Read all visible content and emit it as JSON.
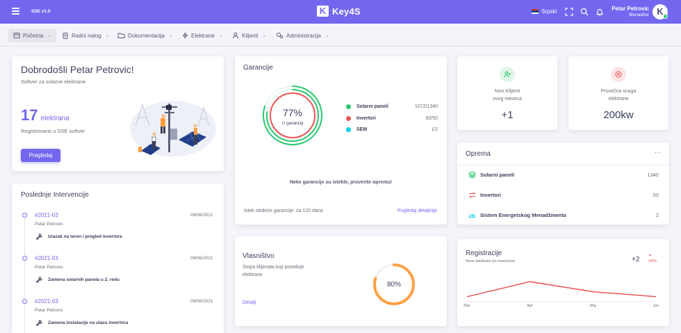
{
  "app": {
    "version": "SSE v1.0",
    "brand_letter": "K",
    "brand_name": "Key4S",
    "language": "Srpski"
  },
  "user": {
    "name": "Petar Petrovic",
    "role": "Menadžer",
    "avatar_letter": "K"
  },
  "nav": [
    {
      "label": "Početna",
      "icon": "home-icon"
    },
    {
      "label": "Radni nalog",
      "icon": "clipboard-icon"
    },
    {
      "label": "Dokumentacija",
      "icon": "folder-icon"
    },
    {
      "label": "Elektrane",
      "icon": "lightning-icon"
    },
    {
      "label": "Klijenti",
      "icon": "user-icon"
    },
    {
      "label": "Administracija",
      "icon": "settings-icon"
    }
  ],
  "welcome": {
    "title": "Dobrodošli Petar Petrovic!",
    "subtitle": "Softver za solarne elektrane",
    "count": "17",
    "count_unit": "elektrana",
    "registered": "Registrovano u SSE softver",
    "button": "Pregledaj"
  },
  "guarantees": {
    "title": "Garancije",
    "percent": "77%",
    "center_label": "U garanciji",
    "percent_value": 77,
    "items": [
      {
        "label": "Solarni paneli",
        "value": "1072/1340",
        "color": "#28c76f"
      },
      {
        "label": "Invertori",
        "value": "50/50",
        "color": "#ea5455"
      },
      {
        "label": "SEM",
        "value": "1/2",
        "color": "#00cfe8"
      }
    ],
    "warning": "Neke garancije su istekle, proverite opremu!",
    "expiry": "Istek sledeće garancije: za 120 dana",
    "details_link": "Pogledaj detaljnije"
  },
  "stat_new_clients": {
    "label_line1": "Novi Klijenti",
    "label_line2": "ovog meseca",
    "value": "+1",
    "color": "#28c76f"
  },
  "stat_avg_power": {
    "label_line1": "Prosečna snaga",
    "label_line2": "elektrane",
    "value": "200kw",
    "color": "#ea5455"
  },
  "equipment": {
    "title": "Oprema",
    "menu": "···",
    "items": [
      {
        "label": "Solarni paneli",
        "value": "1340",
        "color": "#28c76f",
        "icon": "layers-icon"
      },
      {
        "label": "Invertori",
        "value": "50",
        "color": "#ea5455",
        "icon": "swap-arrows-icon"
      },
      {
        "label": "Sistem Energetskog Menadžmenta",
        "value": "2",
        "color": "#00cfe8",
        "icon": "gauge-icon"
      }
    ]
  },
  "interventions": {
    "title": "Poslednje Intervencije",
    "items": [
      {
        "id": "#2021-03",
        "date": "08/06/2021",
        "person": "Petar Petrovic",
        "task": "Izlazak na teren i pregled invertora"
      },
      {
        "id": "#2021-03",
        "date": "08/06/2021",
        "person": "Petar Petrovic",
        "task": "Zamena solarnih panela u 2. redu"
      },
      {
        "id": "#2021-03",
        "date": "08/06/2021",
        "person": "Petar Petrovic",
        "task": "Zamena instalacije na ulazu invertora"
      }
    ]
  },
  "ownership": {
    "title": "Vlasništvo",
    "text_line1": "Stopa klijenata koji poseduje",
    "text_line2": "elektrane",
    "link": "Detalji",
    "percent": "80%",
    "percent_value": 80,
    "color": "#ff9f43"
  },
  "registrations": {
    "title": "Registracije",
    "subtitle": "Nove elektrane po mesecima",
    "value": "+2",
    "change": "-50%",
    "change_color": "#ea5455"
  },
  "chart_data": {
    "type": "line",
    "categories": [
      "Mar",
      "Apr",
      "Maj",
      "Jun"
    ],
    "series": [
      {
        "values": [
          1,
          4,
          2,
          1
        ]
      }
    ],
    "title": "Registracije",
    "ylim": [
      0,
      5
    ]
  }
}
